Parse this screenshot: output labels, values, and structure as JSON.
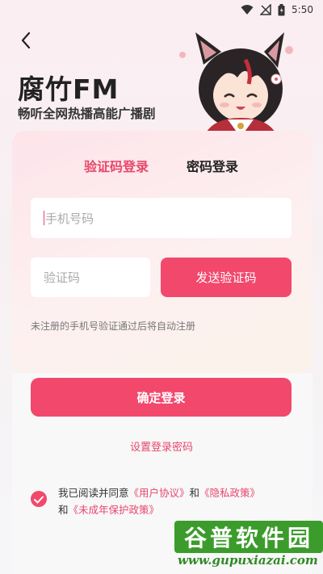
{
  "status": {
    "time": "5:50"
  },
  "header": {
    "title": "腐竹FM",
    "subtitle": "畅听全网热播高能广播剧"
  },
  "tabs": [
    {
      "label": "验证码登录",
      "active": true
    },
    {
      "label": "密码登录",
      "active": false
    }
  ],
  "form": {
    "phone_placeholder": "手机号码",
    "code_placeholder": "验证码",
    "send_code_label": "发送验证码",
    "hint": "未注册的手机号验证通过后将自动注册",
    "confirm_label": "确定登录",
    "set_password_label": "设置登录密码"
  },
  "agreement": {
    "checked": true,
    "prefix": "我已阅读并同意",
    "user_agreement": "《用户协议》",
    "and1": "和",
    "privacy": "《隐私政策》",
    "and2": "和",
    "minor": "《未成年保护政策》"
  },
  "watermark": {
    "brand": "谷普软件园",
    "url": "www.gupuxiazai.com"
  },
  "colors": {
    "accent": "#f2486c",
    "accent_text": "#e8476b"
  },
  "icons": {
    "back": "chevron-left-icon",
    "wifi": "wifi-icon",
    "signal": "signal-icon",
    "battery": "battery-icon",
    "check": "check-icon"
  }
}
